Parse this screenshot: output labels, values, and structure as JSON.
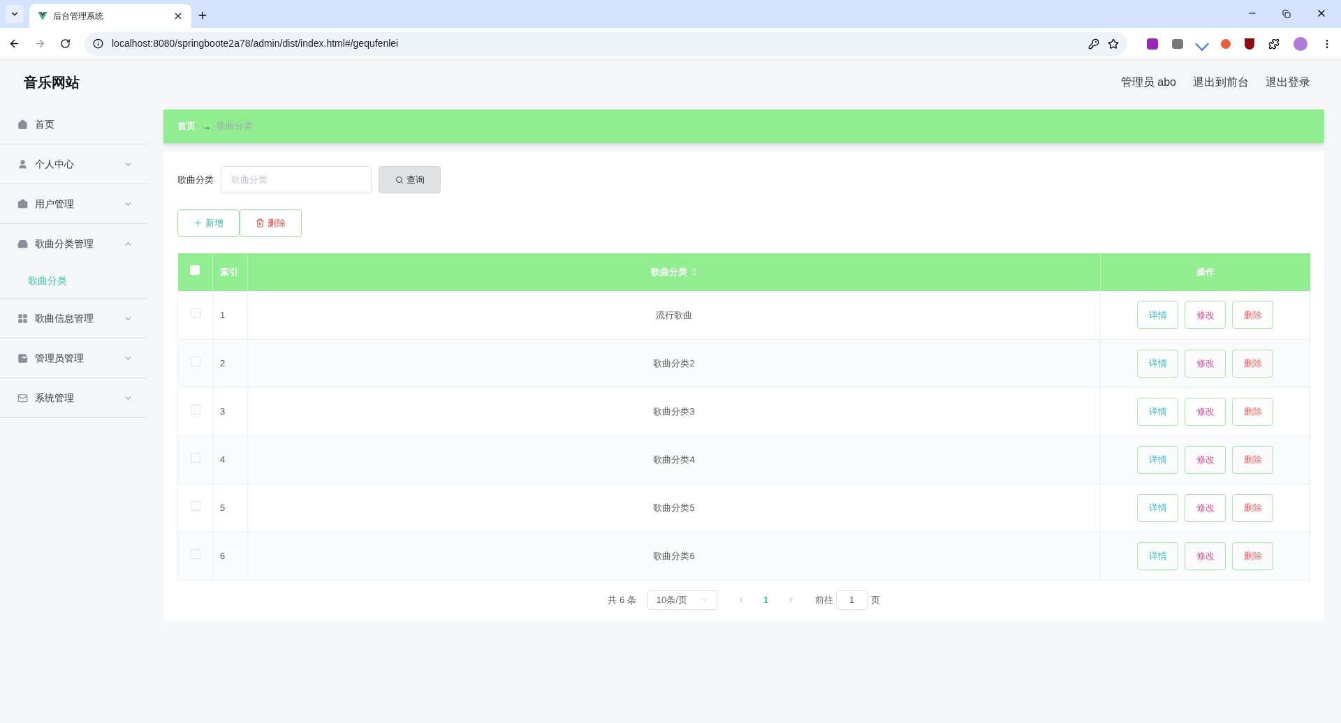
{
  "browser": {
    "tab_title": "后台管理系统",
    "url": "localhost:8080/springboote2a78/admin/dist/index.html#/gequfenlei"
  },
  "header": {
    "site_title": "音乐网站",
    "links": [
      "管理员 abo",
      "退出到前台",
      "退出登录"
    ]
  },
  "sidebar": {
    "items": [
      {
        "kind": "home",
        "label": "首页"
      },
      {
        "kind": "user",
        "label": "个人中心",
        "expanded": false
      },
      {
        "kind": "briefcase",
        "label": "用户管理",
        "expanded": false
      },
      {
        "kind": "box",
        "label": "歌曲分类管理",
        "expanded": true,
        "children": [
          {
            "label": "歌曲分类",
            "selected": true
          }
        ]
      },
      {
        "kind": "grid",
        "label": "歌曲信息管理",
        "expanded": false
      },
      {
        "kind": "wallet",
        "label": "管理员管理",
        "expanded": false
      },
      {
        "kind": "mail",
        "label": "系统管理",
        "expanded": false
      }
    ]
  },
  "breadcrumb": {
    "items": [
      "首页",
      "歌曲分类"
    ],
    "separator": "→"
  },
  "search": {
    "label": "歌曲分类",
    "placeholder": "歌曲分类",
    "button": "查询"
  },
  "actions": {
    "add": "新增",
    "delete": "删除"
  },
  "table": {
    "columns": [
      "索引",
      "歌曲分类",
      "操作"
    ],
    "all_checked": false,
    "rows": [
      {
        "index": "1",
        "name": "流行歌曲",
        "checked": false,
        "actions": [
          "详情",
          "修改",
          "删除"
        ]
      },
      {
        "index": "2",
        "name": "歌曲分类2",
        "checked": false,
        "actions": [
          "详情",
          "修改",
          "删除"
        ]
      },
      {
        "index": "3",
        "name": "歌曲分类3",
        "checked": false,
        "actions": [
          "详情",
          "修改",
          "删除"
        ]
      },
      {
        "index": "4",
        "name": "歌曲分类4",
        "checked": false,
        "actions": [
          "详情",
          "修改",
          "删除"
        ]
      },
      {
        "index": "5",
        "name": "歌曲分类5",
        "checked": false,
        "actions": [
          "详情",
          "修改",
          "删除"
        ]
      },
      {
        "index": "6",
        "name": "歌曲分类6",
        "checked": false,
        "actions": [
          "详情",
          "修改",
          "删除"
        ]
      }
    ]
  },
  "pagination": {
    "total": "共 6 条",
    "page_size": "10条/页",
    "pages": [
      {
        "label": "1",
        "selected": true
      }
    ],
    "goto_label": "前往",
    "goto_value": "1",
    "page_suffix": "页"
  }
}
